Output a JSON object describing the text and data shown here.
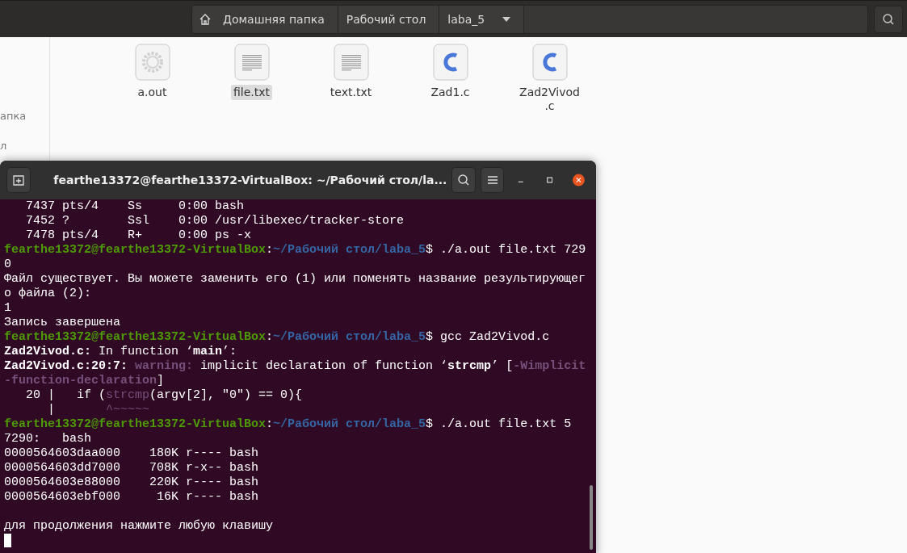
{
  "file_manager": {
    "pathbar": [
      {
        "label": "Домашняя папка",
        "home": true,
        "dropdown": false
      },
      {
        "label": "Рабочий стол",
        "home": false,
        "dropdown": false
      },
      {
        "label": "laba_5",
        "home": false,
        "dropdown": true
      }
    ],
    "sidebar": {
      "items": [
        "апка",
        "л"
      ]
    },
    "files": [
      {
        "name": "a.out",
        "kind": "executable",
        "selected": false
      },
      {
        "name": "file.txt",
        "kind": "text",
        "selected": true
      },
      {
        "name": "text.txt",
        "kind": "text",
        "selected": false
      },
      {
        "name": "Zad1.c",
        "kind": "c",
        "selected": false
      },
      {
        "name": "Zad2Vivod.c",
        "kind": "c",
        "selected": false
      }
    ]
  },
  "terminal": {
    "title": "fearthe13372@fearthe13372-VirtualBox: ~/Рабочий стол/la...",
    "lines": [
      {
        "blank_before": false,
        "segments": [
          {
            "text": "   7437 pts/4    Ss     0:00 bash",
            "kind": "plain"
          }
        ]
      },
      {
        "blank_before": false,
        "segments": [
          {
            "text": "   7452 ?        Ssl    0:00 /usr/libexec/tracker-store",
            "kind": "plain"
          }
        ]
      },
      {
        "blank_before": false,
        "segments": [
          {
            "text": "   7478 pts/4    R+     0:00 ps -x",
            "kind": "plain"
          }
        ]
      },
      {
        "blank_before": false,
        "segments": [
          {
            "text": "fearthe13372@fearthe13372-VirtualBox",
            "kind": "user"
          },
          {
            "text": ":",
            "kind": "plain"
          },
          {
            "text": "~/Рабочий стол/laba_5",
            "kind": "path"
          },
          {
            "text": "$ ./a.out file.txt 729",
            "kind": "plain"
          }
        ]
      },
      {
        "blank_before": false,
        "segments": [
          {
            "text": "0",
            "kind": "plain"
          }
        ]
      },
      {
        "blank_before": false,
        "segments": [
          {
            "text": "Файл существует. Вы можете заменить его (1) или поменять название результирующег",
            "kind": "plain"
          }
        ]
      },
      {
        "blank_before": false,
        "segments": [
          {
            "text": "о файла (2):",
            "kind": "plain"
          }
        ]
      },
      {
        "blank_before": false,
        "segments": [
          {
            "text": "1",
            "kind": "plain"
          }
        ]
      },
      {
        "blank_before": false,
        "segments": [
          {
            "text": "Запись завершена",
            "kind": "plain"
          }
        ]
      },
      {
        "blank_before": false,
        "segments": [
          {
            "text": "fearthe13372@fearthe13372-VirtualBox",
            "kind": "user"
          },
          {
            "text": ":",
            "kind": "plain"
          },
          {
            "text": "~/Рабочий стол/laba_5",
            "kind": "path"
          },
          {
            "text": "$ gcc Zad2Vivod.c",
            "kind": "plain"
          }
        ]
      },
      {
        "blank_before": false,
        "segments": [
          {
            "text": "Zad2Vivod.c:",
            "kind": "bold"
          },
          {
            "text": " In function ‘",
            "kind": "plain"
          },
          {
            "text": "main",
            "kind": "bold"
          },
          {
            "text": "’:",
            "kind": "plain"
          }
        ]
      },
      {
        "blank_before": false,
        "segments": [
          {
            "text": "Zad2Vivod.c:20:7:",
            "kind": "bold"
          },
          {
            "text": " warning:",
            "kind": "warning"
          },
          {
            "text": " implicit declaration of function ‘",
            "kind": "plain"
          },
          {
            "text": "strcmp",
            "kind": "bold"
          },
          {
            "text": "’ [",
            "kind": "plain"
          },
          {
            "text": "-Wimplicit",
            "kind": "warning"
          }
        ]
      },
      {
        "blank_before": false,
        "segments": [
          {
            "text": "-function-declaration",
            "kind": "warning"
          },
          {
            "text": "]",
            "kind": "plain"
          }
        ]
      },
      {
        "blank_before": false,
        "segments": [
          {
            "text": "   20 |   if (",
            "kind": "plain"
          },
          {
            "text": "strcmp",
            "kind": "highlight"
          },
          {
            "text": "(argv[2], \"0\") == 0){",
            "kind": "plain"
          }
        ]
      },
      {
        "blank_before": false,
        "segments": [
          {
            "text": "      |       ",
            "kind": "plain"
          },
          {
            "text": "^~~~~~",
            "kind": "highlight"
          }
        ]
      },
      {
        "blank_before": false,
        "segments": [
          {
            "text": "fearthe13372@fearthe13372-VirtualBox",
            "kind": "user"
          },
          {
            "text": ":",
            "kind": "plain"
          },
          {
            "text": "~/Рабочий стол/laba_5",
            "kind": "path"
          },
          {
            "text": "$ ./a.out file.txt 5",
            "kind": "plain"
          }
        ]
      },
      {
        "blank_before": false,
        "segments": [
          {
            "text": "7290:   bash",
            "kind": "plain"
          }
        ]
      },
      {
        "blank_before": false,
        "segments": [
          {
            "text": "0000564603daa000    180K r---- bash",
            "kind": "plain"
          }
        ]
      },
      {
        "blank_before": false,
        "segments": [
          {
            "text": "0000564603dd7000    708K r-x-- bash",
            "kind": "plain"
          }
        ]
      },
      {
        "blank_before": false,
        "segments": [
          {
            "text": "0000564603e88000    220K r---- bash",
            "kind": "plain"
          }
        ]
      },
      {
        "blank_before": false,
        "segments": [
          {
            "text": "0000564603ebf000     16K r---- bash",
            "kind": "plain"
          }
        ]
      },
      {
        "blank_before": true,
        "segments": [
          {
            "text": "для продолжения нажмите любую клавишу",
            "kind": "plain"
          }
        ]
      }
    ]
  }
}
